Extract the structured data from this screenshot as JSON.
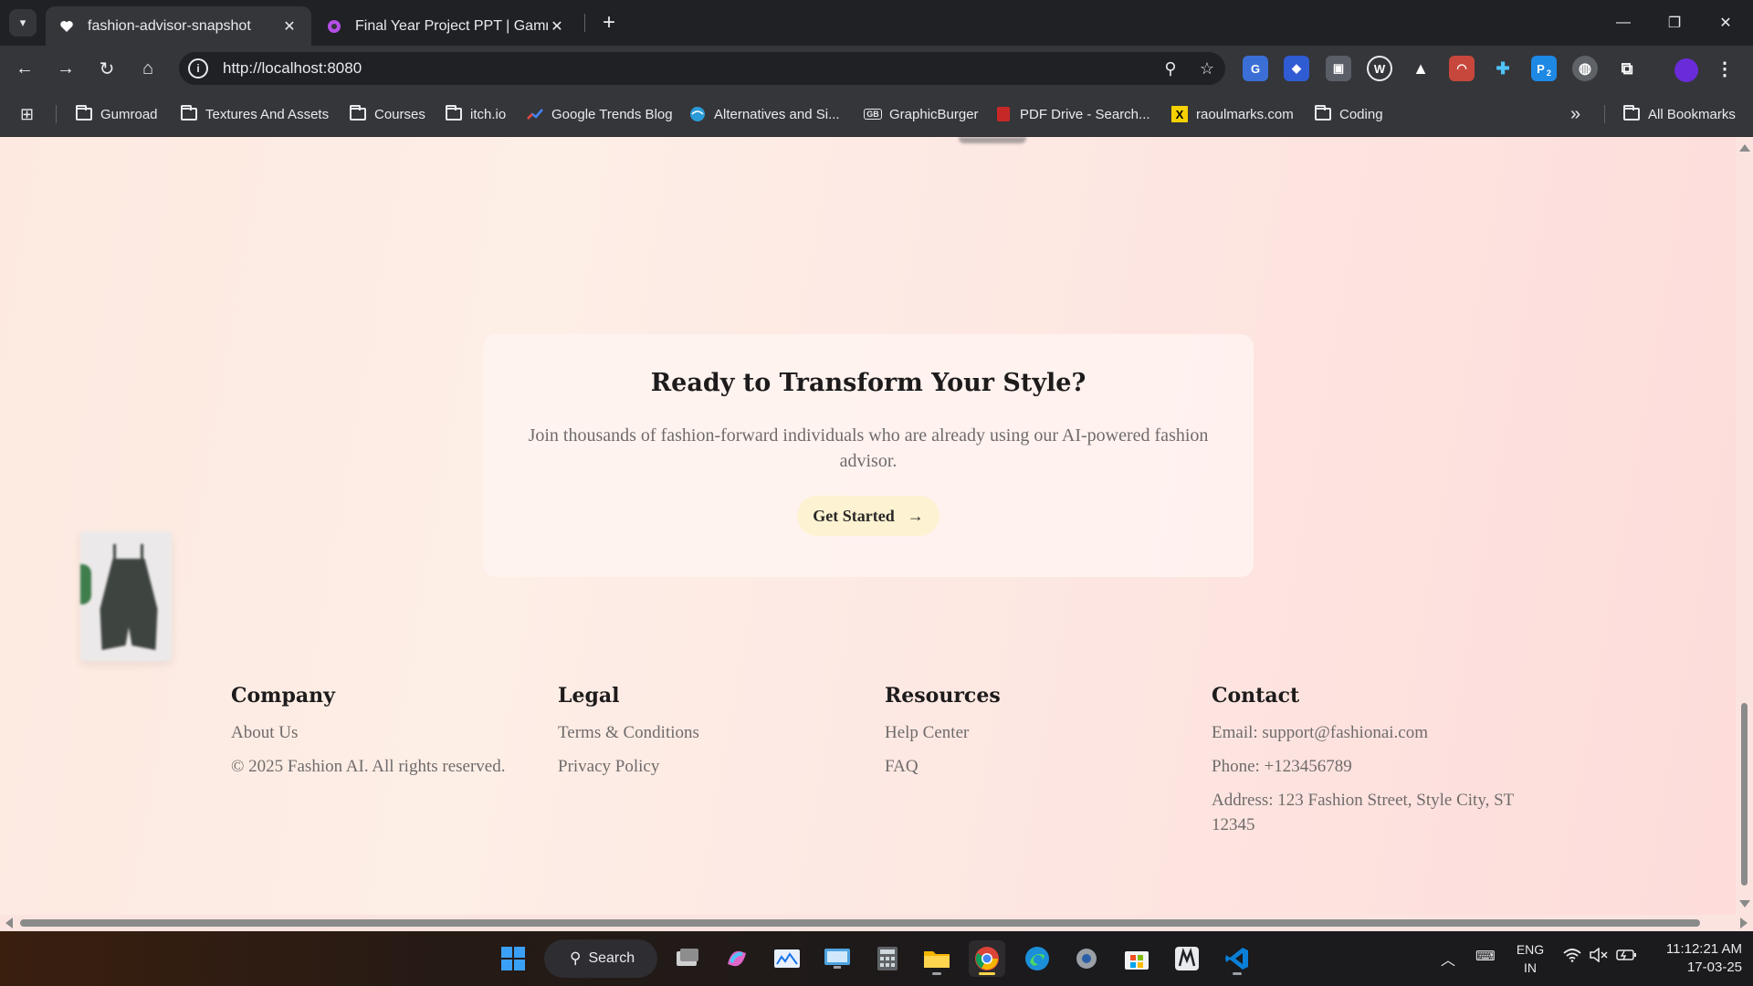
{
  "browser": {
    "tabs": [
      {
        "title": "fashion-advisor-snapshot",
        "icon": "heart-icon",
        "active": true
      },
      {
        "title": "Final Year Project PPT | Gamma",
        "icon": "gamma-icon",
        "active": false
      }
    ],
    "new_tab_label": "+",
    "address_url": "http://localhost:8080",
    "bookmarks": [
      {
        "label": "Gumroad",
        "icon": "folder-icon"
      },
      {
        "label": "Textures And Assets",
        "icon": "folder-icon"
      },
      {
        "label": "Courses",
        "icon": "folder-icon"
      },
      {
        "label": "itch.io",
        "icon": "folder-icon"
      },
      {
        "label": "Google Trends Blog",
        "icon": "trends-icon"
      },
      {
        "label": "Alternatives and Si...",
        "icon": "globe-icon"
      },
      {
        "label": "GraphicBurger",
        "icon": "gb-icon"
      },
      {
        "label": "PDF Drive - Search...",
        "icon": "pdf-icon"
      },
      {
        "label": "raoulmarks.com",
        "icon": "x-icon"
      },
      {
        "label": "Coding",
        "icon": "folder-icon"
      }
    ],
    "more_bookmarks_label": "»",
    "all_bookmarks_label": "All Bookmarks",
    "extension_badge": "2"
  },
  "page": {
    "cta": {
      "title": "Ready to Transform Your Style?",
      "subtitle": "Join thousands of fashion-forward individuals who are already using our AI-powered fashion advisor.",
      "button_label": "Get Started"
    },
    "footer": {
      "company": {
        "heading": "Company",
        "links": [
          "About Us",
          "© 2025 Fashion AI. All rights reserved."
        ]
      },
      "legal": {
        "heading": "Legal",
        "links": [
          "Terms & Conditions",
          "Privacy Policy"
        ]
      },
      "resources": {
        "heading": "Resources",
        "links": [
          "Help Center",
          "FAQ"
        ]
      },
      "contact": {
        "heading": "Contact",
        "links": [
          "Email: support@fashionai.com",
          "Phone: +123456789",
          "Address: 123 Fashion Street, Style City, ST 12345"
        ]
      }
    }
  },
  "taskbar": {
    "search_label": "Search",
    "language": "ENG",
    "region": "IN",
    "time": "11:12:21 AM",
    "date": "17-03-25"
  },
  "colors": {
    "page_background": "#fde9e0",
    "cta_button": "#fdf3d2",
    "browser_chrome": "#35363a",
    "taskbar": "#1b1a1d"
  }
}
